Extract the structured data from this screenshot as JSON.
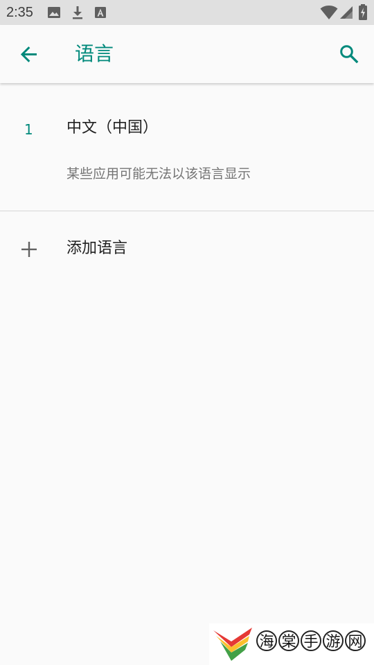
{
  "status_bar": {
    "time": "2:35",
    "left_icons": [
      "image-icon",
      "download-icon",
      "font-a-icon"
    ],
    "right_icons": [
      "wifi-icon",
      "cell-signal-icon",
      "battery-charging-icon"
    ]
  },
  "app_bar": {
    "title": "语言",
    "back_icon": "arrow-back-icon",
    "search_icon": "search-icon",
    "accent_color": "#00897b"
  },
  "languages": [
    {
      "index": "1",
      "name": "中文（中国）",
      "note": "某些应用可能无法以该语言显示"
    }
  ],
  "add_language": {
    "icon": "plus-icon",
    "label": "添加语言"
  },
  "watermark": {
    "chars": [
      "海",
      "棠",
      "手",
      "游",
      "网"
    ]
  }
}
